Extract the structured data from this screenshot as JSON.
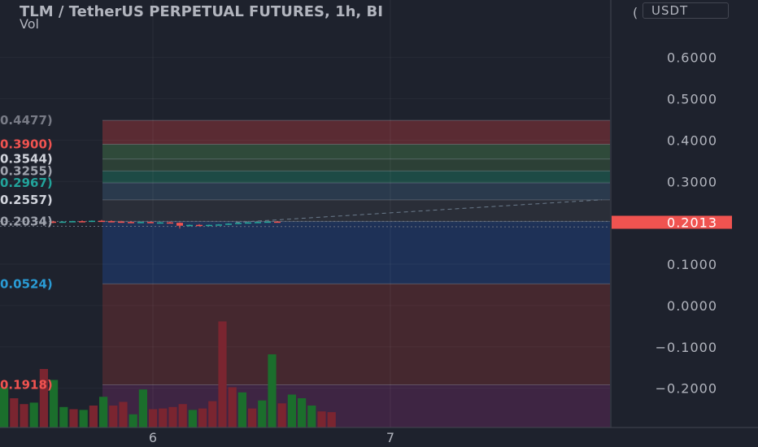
{
  "header": {
    "title": "TLM / TetherUS PERPETUAL FUTURES, 1h, BI",
    "vol_label": "Vol"
  },
  "currency_button": {
    "label": "USDT",
    "clipped_char": "("
  },
  "price_axis": {
    "ticks": [
      0.6,
      0.5,
      0.4,
      0.3,
      0.2,
      0.1,
      0.0,
      -0.1,
      -0.2
    ],
    "tick_labels": [
      "0.6000",
      "0.5000",
      "0.4000",
      "0.3000",
      "0.1000",
      "0.0000",
      "−0.1000",
      "−0.2000"
    ],
    "current_price_label": "0.2013",
    "current_price": 0.2013,
    "current_price_color": "#f05350"
  },
  "time_axis": {
    "labels": [
      "6",
      "7"
    ]
  },
  "levels": [
    {
      "label": "0.4477)",
      "price": 0.4477,
      "color": "#787b86"
    },
    {
      "label": "0.3900)",
      "price": 0.39,
      "color": "#f05350"
    },
    {
      "label": "0.3544)",
      "price": 0.3544,
      "color": "#d1d4dc"
    },
    {
      "label": "0.3255)",
      "price": 0.3255,
      "color": "#9fa3ad"
    },
    {
      "label": "0.2967)",
      "price": 0.2967,
      "color": "#22a39a"
    },
    {
      "label": "0.2557)",
      "price": 0.2557,
      "color": "#d1d4dc"
    },
    {
      "label": "0.2034)",
      "price": 0.2034,
      "color": "#9fa3ad"
    },
    {
      "label": "0.0524)",
      "price": 0.0524,
      "color": "#2a9bd4"
    },
    {
      "label": "0.1918)",
      "price": -0.1918,
      "color": "#f05350"
    }
  ],
  "colors": {
    "background": "#1e222d",
    "up": "#26a69a",
    "down": "#ef5350",
    "vol_up": "#1b6e2c",
    "vol_down": "#7a2530"
  },
  "chart_data": {
    "type": "candlestick",
    "x": [
      "6",
      "7"
    ],
    "y_range": [
      -0.2,
      0.6
    ],
    "current_price": 0.2013,
    "zones": [
      {
        "from": 0.4477,
        "to": 0.39,
        "color": "#5a2b33"
      },
      {
        "from": 0.39,
        "to": 0.3544,
        "color": "#2f4a3a"
      },
      {
        "from": 0.3544,
        "to": 0.3255,
        "color": "#2c4036"
      },
      {
        "from": 0.3255,
        "to": 0.2967,
        "color": "#1d4a45"
      },
      {
        "from": 0.2967,
        "to": 0.2557,
        "color": "#2a3a4d"
      },
      {
        "from": 0.2557,
        "to": 0.2034,
        "color": "#2a2e38"
      },
      {
        "from": 0.2034,
        "to": 0.0524,
        "color": "#1e3157"
      },
      {
        "from": 0.0524,
        "to": -0.1918,
        "color": "#45282f"
      },
      {
        "from": -0.1918,
        "to": -0.3,
        "color": "#3e2543"
      }
    ],
    "candles": [
      {
        "o": 0.203,
        "h": 0.205,
        "l": 0.199,
        "c": 0.2,
        "up": false
      },
      {
        "o": 0.201,
        "h": 0.204,
        "l": 0.2,
        "c": 0.203,
        "up": true
      },
      {
        "o": 0.203,
        "h": 0.205,
        "l": 0.202,
        "c": 0.204,
        "up": true
      },
      {
        "o": 0.204,
        "h": 0.206,
        "l": 0.202,
        "c": 0.203,
        "up": false
      },
      {
        "o": 0.203,
        "h": 0.206,
        "l": 0.202,
        "c": 0.205,
        "up": true
      },
      {
        "o": 0.205,
        "h": 0.207,
        "l": 0.203,
        "c": 0.204,
        "up": false
      },
      {
        "o": 0.204,
        "h": 0.206,
        "l": 0.202,
        "c": 0.203,
        "up": false
      },
      {
        "o": 0.203,
        "h": 0.205,
        "l": 0.202,
        "c": 0.202,
        "up": false
      },
      {
        "o": 0.202,
        "h": 0.204,
        "l": 0.2,
        "c": 0.201,
        "up": false
      },
      {
        "o": 0.201,
        "h": 0.203,
        "l": 0.2,
        "c": 0.202,
        "up": true
      },
      {
        "o": 0.202,
        "h": 0.203,
        "l": 0.2,
        "c": 0.2,
        "up": false
      },
      {
        "o": 0.2,
        "h": 0.202,
        "l": 0.199,
        "c": 0.201,
        "up": true
      },
      {
        "o": 0.201,
        "h": 0.203,
        "l": 0.199,
        "c": 0.2,
        "up": false
      },
      {
        "o": 0.2,
        "h": 0.201,
        "l": 0.186,
        "c": 0.193,
        "up": false
      },
      {
        "o": 0.193,
        "h": 0.196,
        "l": 0.191,
        "c": 0.195,
        "up": true
      },
      {
        "o": 0.195,
        "h": 0.197,
        "l": 0.193,
        "c": 0.194,
        "up": false
      },
      {
        "o": 0.194,
        "h": 0.196,
        "l": 0.193,
        "c": 0.195,
        "up": true
      },
      {
        "o": 0.195,
        "h": 0.197,
        "l": 0.194,
        "c": 0.196,
        "up": true
      },
      {
        "o": 0.196,
        "h": 0.199,
        "l": 0.195,
        "c": 0.198,
        "up": true
      },
      {
        "o": 0.198,
        "h": 0.201,
        "l": 0.197,
        "c": 0.2,
        "up": true
      },
      {
        "o": 0.2,
        "h": 0.202,
        "l": 0.199,
        "c": 0.201,
        "up": true
      },
      {
        "o": 0.201,
        "h": 0.203,
        "l": 0.2,
        "c": 0.202,
        "up": true
      },
      {
        "o": 0.202,
        "h": 0.204,
        "l": 0.201,
        "c": 0.203,
        "up": true
      },
      {
        "o": 0.203,
        "h": 0.204,
        "l": 0.201,
        "c": 0.202,
        "up": false
      }
    ],
    "volume": [
      {
        "v": 0.55,
        "up": true
      },
      {
        "v": 0.4,
        "up": false
      },
      {
        "v": 0.32,
        "up": false
      },
      {
        "v": 0.34,
        "up": true
      },
      {
        "v": 0.8,
        "up": false
      },
      {
        "v": 0.65,
        "up": true
      },
      {
        "v": 0.28,
        "up": true
      },
      {
        "v": 0.25,
        "up": false
      },
      {
        "v": 0.24,
        "up": true
      },
      {
        "v": 0.3,
        "up": false
      },
      {
        "v": 0.42,
        "up": true
      },
      {
        "v": 0.3,
        "up": false
      },
      {
        "v": 0.35,
        "up": false
      },
      {
        "v": 0.18,
        "up": true
      },
      {
        "v": 0.52,
        "up": true
      },
      {
        "v": 0.25,
        "up": false
      },
      {
        "v": 0.26,
        "up": false
      },
      {
        "v": 0.28,
        "up": false
      },
      {
        "v": 0.32,
        "up": false
      },
      {
        "v": 0.24,
        "up": true
      },
      {
        "v": 0.26,
        "up": false
      },
      {
        "v": 0.36,
        "up": false
      },
      {
        "v": 1.45,
        "up": false
      },
      {
        "v": 0.55,
        "up": false
      },
      {
        "v": 0.48,
        "up": true
      },
      {
        "v": 0.26,
        "up": false
      },
      {
        "v": 0.37,
        "up": true
      },
      {
        "v": 1.0,
        "up": true
      },
      {
        "v": 0.33,
        "up": false
      },
      {
        "v": 0.45,
        "up": true
      },
      {
        "v": 0.4,
        "up": true
      },
      {
        "v": 0.3,
        "up": true
      },
      {
        "v": 0.22,
        "up": false
      },
      {
        "v": 0.21,
        "up": false
      }
    ]
  }
}
